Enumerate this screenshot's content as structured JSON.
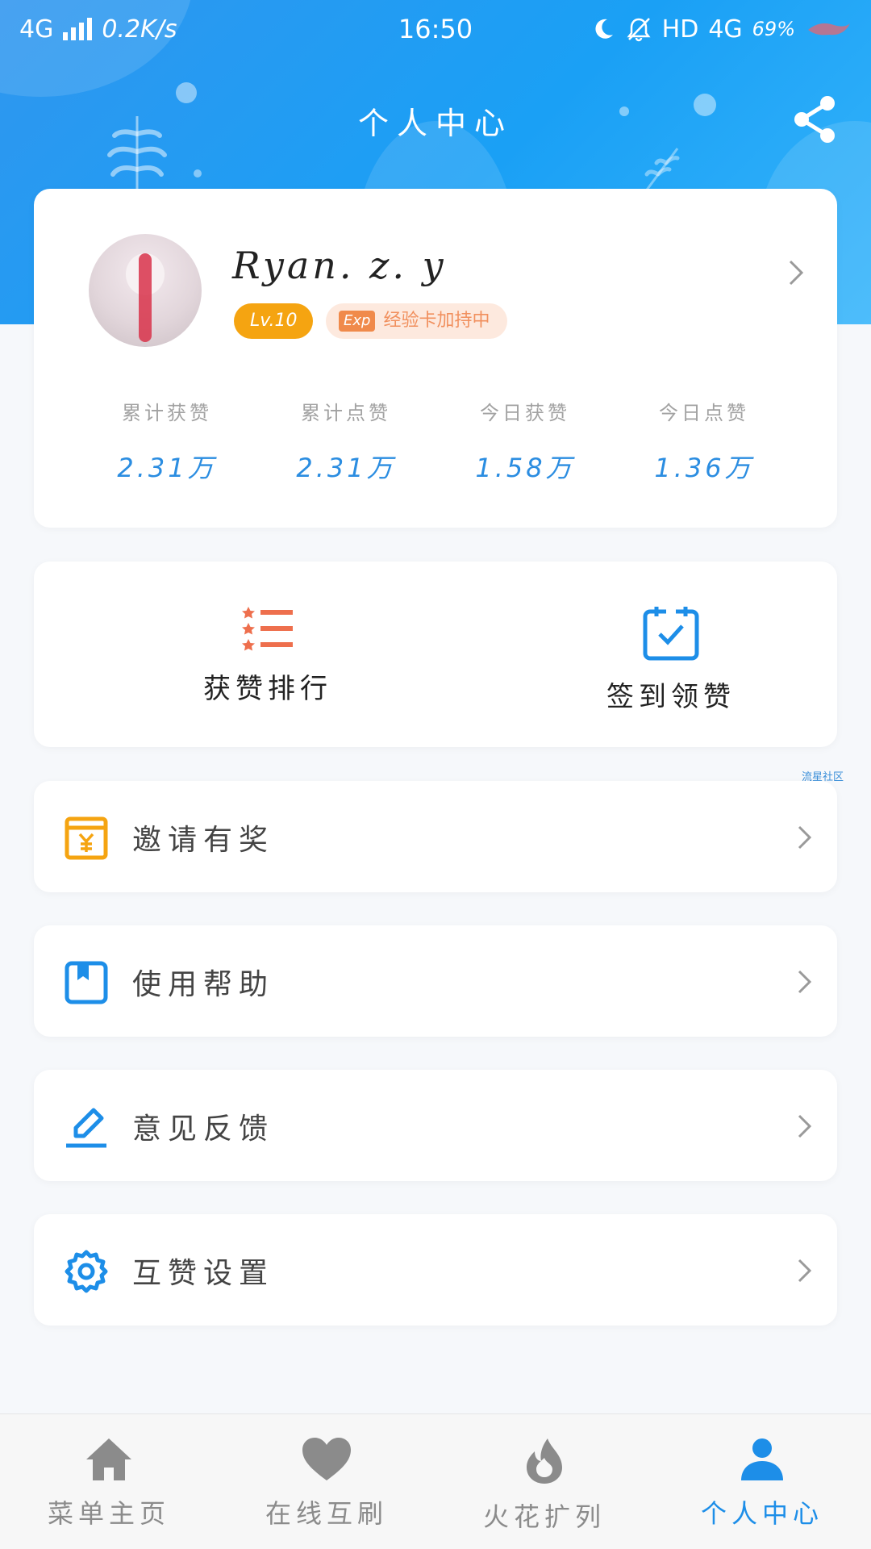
{
  "status_bar": {
    "network": "4G",
    "speed": "0.2K/s",
    "time": "16:50",
    "hd": "HD",
    "network_right": "4G",
    "battery": "69%"
  },
  "header": {
    "title": "个人中心"
  },
  "profile": {
    "username": "Ryan. z. y",
    "level": "Lv.10",
    "exp_tag": "Exp",
    "exp_text": "经验卡加持中",
    "stats": [
      {
        "label": "累计获赞",
        "value": "2.31万"
      },
      {
        "label": "累计点赞",
        "value": "2.31万"
      },
      {
        "label": "今日获赞",
        "value": "1.58万"
      },
      {
        "label": "今日点赞",
        "value": "1.36万"
      }
    ]
  },
  "actions": [
    {
      "label": "获赞排行",
      "icon": "ranking-list-icon"
    },
    {
      "label": "签到领赞",
      "icon": "calendar-check-icon"
    }
  ],
  "watermark": "流星社区",
  "menu": [
    {
      "label": "邀请有奖",
      "icon": "yen-gift-icon"
    },
    {
      "label": "使用帮助",
      "icon": "book-icon"
    },
    {
      "label": "意见反馈",
      "icon": "edit-pen-icon"
    },
    {
      "label": "互赞设置",
      "icon": "gear-icon"
    }
  ],
  "tabs": [
    {
      "label": "菜单主页",
      "icon": "home-icon"
    },
    {
      "label": "在线互刷",
      "icon": "heart-icon"
    },
    {
      "label": "火花扩列",
      "icon": "flame-icon"
    },
    {
      "label": "个人中心",
      "icon": "user-icon",
      "active": true
    }
  ],
  "colors": {
    "primary": "#1d8ee8",
    "header_gradient_start": "#2f96ef",
    "level_badge": "#f5a411",
    "exp_badge_bg": "#fde9de",
    "ranking_icon": "#ee6f4d",
    "invite_icon": "#f5a411",
    "tab_inactive": "#8b8b8b"
  }
}
